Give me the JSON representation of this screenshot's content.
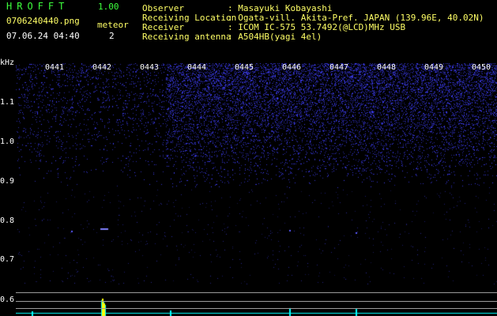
{
  "header": {
    "app_title": "HROFFT",
    "app_version": "1.00",
    "filename": "0706240440.png",
    "datetime": "07.06.24 04:40",
    "meteor_label": "meteor",
    "meteor_count": "2"
  },
  "info": {
    "observer_key": "Observer",
    "observer_val": ": Masayuki Kobayashi",
    "location_key": "Receiving Location",
    "location_val": ": Ogata-vill. Akita-Pref. JAPAN (139.96E, 40.02N)",
    "receiver_key": "Receiver",
    "receiver_val": ": ICOM IC-575 53.7492(@LCD)MHz USB",
    "antenna_key": "Receiving antenna",
    "antenna_val": ": A504HB(yagi 4el)"
  },
  "axis": {
    "unit": "kHz",
    "x_ticks": [
      "0441",
      "0442",
      "0443",
      "0444",
      "0445",
      "0446",
      "0447",
      "0448",
      "0449",
      "0450"
    ],
    "y_ticks": [
      "1.1",
      "1.0",
      "0.9",
      "0.8",
      "0.7",
      "0.6"
    ]
  },
  "colors": {
    "label_green": "#3dff3d",
    "label_yellow": "#ffff66",
    "noise_blue": "#3a3aff",
    "signal_cyan": "#00ffff",
    "signal_yellow": "#ffff00"
  }
}
